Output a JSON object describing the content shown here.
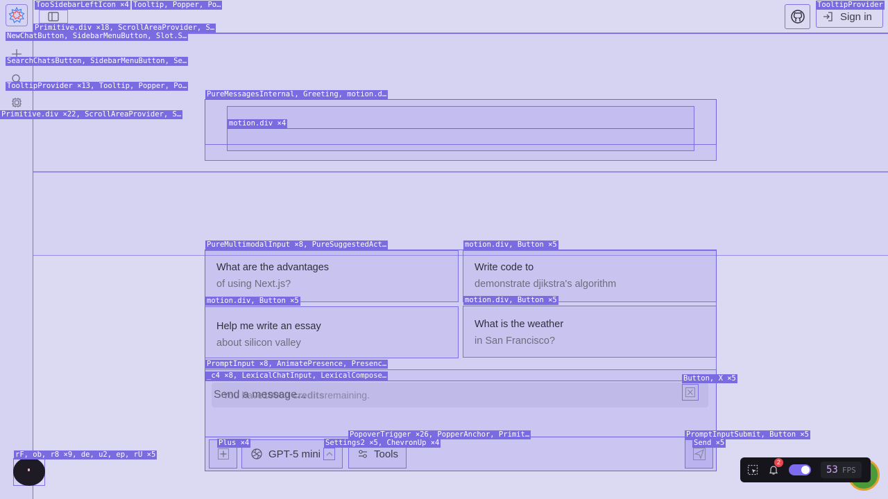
{
  "tags": {
    "sidebar_tooltip": "Too",
    "sidebar_left_icon": "SidebarLeftIcon ×4",
    "tooltip_popper": "Tooltip, Popper, Po…",
    "primitive_div_18": "Primitive.div ×18, ScrollAreaProvider, S…",
    "new_chat": "NewChatButton, SidebarMenuButton, Slot.S…",
    "search_chats": "SearchChatsButton, SidebarMenuButton, Se…",
    "tooltip_provider_13": "TooltipProvider ×13, Tooltip, Popper, Po…",
    "primitive_div_22": "Primitive.div ×22, ScrollAreaProvider, S…",
    "tooltip_provider": "TooltipProvider",
    "pure_messages": "PureMessagesInternal, Greeting, motion.d…",
    "motion_div_4": "motion.div ×4",
    "pure_multimodal": "PureMultimodalInput ×8, PureSuggestedAct…",
    "motion_div_btn_1": "motion.div, Button ×5",
    "motion_div_btn_2": "motion.div, Button ×5",
    "motion_div_btn_3": "motion.div, Button ×5",
    "prompt_input": "PromptInput ×8, AnimatePresence, Presenc…",
    "c4": "_c4 ×8, LexicalChatInput, LexicalCompose…",
    "button_x": "Button, X ×5",
    "popover_trigger": "PopoverTrigger ×26, PopperAnchor, Primit…",
    "plus": "Plus ×4",
    "settings2": "Settings2 ×5, ChevronUp ×4",
    "prompt_submit": "PromptInputSubmit, Button ×5",
    "send": "Send ×5",
    "rf": "rF, ob, r8 ×9, de, u2, ep, rU ×5"
  },
  "header": {
    "sign_in_label": "Sign in"
  },
  "suggestions": [
    {
      "title": "What are the advantages",
      "subtitle": "of using Next.js?"
    },
    {
      "title": "Write code to",
      "subtitle": "demonstrate djikstra's algorithm"
    },
    {
      "title": "Help me write an essay",
      "subtitle": "about silicon valley"
    },
    {
      "title": "What is the weather",
      "subtitle": "in San Francisco?"
    }
  ],
  "credits": {
    "prefix": "You have ",
    "amount": "10000 credits",
    "suffix": " remaining."
  },
  "input": {
    "placeholder": "Send a message..."
  },
  "toolbar": {
    "model_label": "GPT-5 mini",
    "tools_label": "Tools"
  },
  "devtools": {
    "notification_count": "2",
    "fps_value": "53",
    "fps_label": "FPS"
  },
  "colors": {
    "accent": "#7a6be0",
    "toggle": "#7c6cf0",
    "fps_value": "#d9a6ff",
    "badge": "#e5484d"
  }
}
